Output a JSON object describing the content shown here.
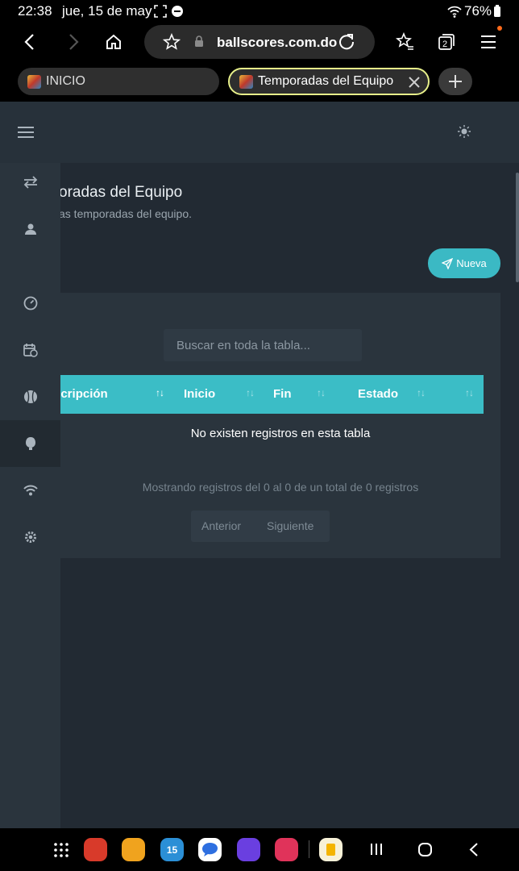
{
  "status_bar": {
    "time": "22:38",
    "date": "jue, 15 de may",
    "battery": "76%"
  },
  "browser": {
    "url": "ballscores.com.do",
    "tabs": [
      {
        "label": "INICIO",
        "active": false
      },
      {
        "label": "Temporadas del Equipo",
        "active": true
      }
    ],
    "notification_color": "#ff6a1a"
  },
  "page": {
    "title_fragment_1": "(",
    "title": "oradas del Equipo",
    "subtitle": "as temporadas del equipo.",
    "title_fragment_2": "/",
    "new_button": "Nueva",
    "accent_color": "#3bbdc6"
  },
  "sidebar": {
    "items": [
      {
        "icon": "swap-arrows-icon"
      },
      {
        "icon": "user-icon"
      },
      {
        "icon": "dashboard-gauge-icon"
      },
      {
        "icon": "calendar-clock-icon"
      },
      {
        "icon": "baseball-icon"
      },
      {
        "icon": "trophy-icon",
        "active": true
      },
      {
        "icon": "wifi-icon"
      },
      {
        "icon": "settings-gear-icon"
      }
    ]
  },
  "table": {
    "search_placeholder": "Buscar en toda la tabla...",
    "columns": [
      "scripción",
      "Inicio",
      "Fin",
      "Estado",
      ""
    ],
    "empty_message": "No existen registros en esta tabla",
    "info": "Mostrando registros del 0 al 0 de un total de 0 registros",
    "prev": "Anterior",
    "next": "Siguiente"
  },
  "dock": {
    "apps": [
      "grid-icon",
      "flipboard-icon",
      "files-icon",
      "calendar-icon",
      "messages-icon",
      "internet-icon",
      "camera-icon",
      "keep-icon"
    ]
  }
}
